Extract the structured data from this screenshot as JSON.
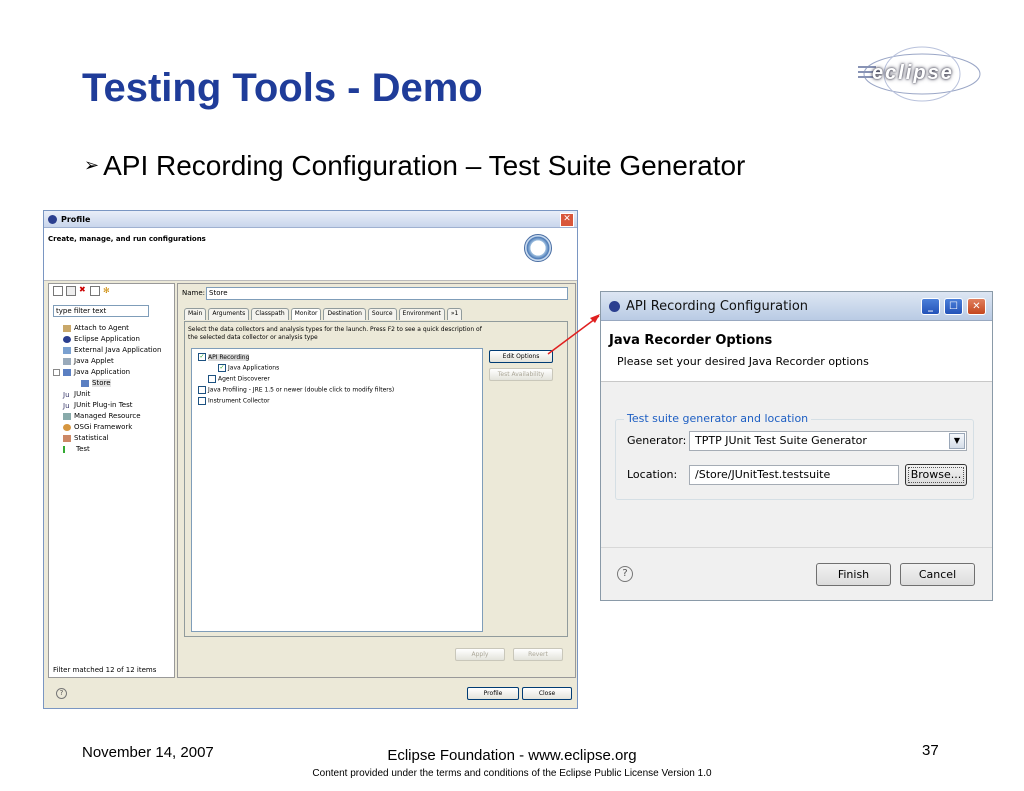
{
  "slide": {
    "title": "Testing Tools - Demo",
    "bullet": "API Recording Configuration – Test Suite Generator",
    "bullet_marker": "➢",
    "logo_text": "eclipse"
  },
  "profile_dialog": {
    "title": "Profile",
    "header": "Create, manage, and run configurations",
    "filter_placeholder": "type filter text",
    "tree": [
      {
        "label": "Attach to Agent"
      },
      {
        "label": "Eclipse Application"
      },
      {
        "label": "External Java Application"
      },
      {
        "label": "Java Applet"
      },
      {
        "label": "Java Application"
      },
      {
        "label": "Store"
      },
      {
        "label": "JUnit"
      },
      {
        "label": "JUnit Plug-in Test"
      },
      {
        "label": "Managed Resource"
      },
      {
        "label": "OSGi Framework"
      },
      {
        "label": "Statistical"
      },
      {
        "label": "Test"
      }
    ],
    "filter_status": "Filter matched 12 of 12 items",
    "name_label": "Name:",
    "name_value": "Store",
    "tabs": [
      "Main",
      "Arguments",
      "Classpath",
      "Monitor",
      "Destination",
      "Source",
      "Environment",
      "»1"
    ],
    "description": "Select the data collectors and analysis types for the launch. Press F2 to see a quick description of the selected data collector or analysis type",
    "analysis_tree": [
      {
        "label": "API Recording",
        "checked": true
      },
      {
        "label": "Java Applications",
        "checked": true
      },
      {
        "label": "Agent Discoverer",
        "checked": false
      },
      {
        "label": "Java Profiling - JRE 1.5 or newer (double click to modify filters)",
        "checked": false
      },
      {
        "label": "Instrument Collector",
        "checked": false
      }
    ],
    "edit_options": "Edit Options",
    "test_availability": "Test Availability",
    "apply": "Apply",
    "revert": "Revert",
    "profile": "Profile",
    "close": "Close",
    "help": "?",
    "close_glyph": "✕"
  },
  "api_dialog": {
    "title": "API Recording Configuration",
    "header_title": "Java Recorder Options",
    "header_subtitle": "Please set your desired Java Recorder options",
    "group_legend": "Test suite generator and location",
    "generator_label": "Generator:",
    "generator_value": "TPTP JUnit Test Suite Generator",
    "location_label": "Location:",
    "location_value": "/Store/JUnitTest.testsuite",
    "browse": "Browse...",
    "finish": "Finish",
    "cancel": "Cancel",
    "help": "?",
    "minimize_glyph": "_",
    "maximize_glyph": "☐",
    "close_glyph": "✕",
    "dropdown_glyph": "▼"
  },
  "footer": {
    "date": "November 14, 2007",
    "center": "Eclipse Foundation - www.eclipse.org",
    "license": "Content provided under the terms and conditions of the Eclipse Public License Version 1.0",
    "page": "37"
  },
  "colors": {
    "title_blue": "#1f3c99",
    "group_legend_blue": "#1e5fc3",
    "arrow_red": "#e02020"
  }
}
